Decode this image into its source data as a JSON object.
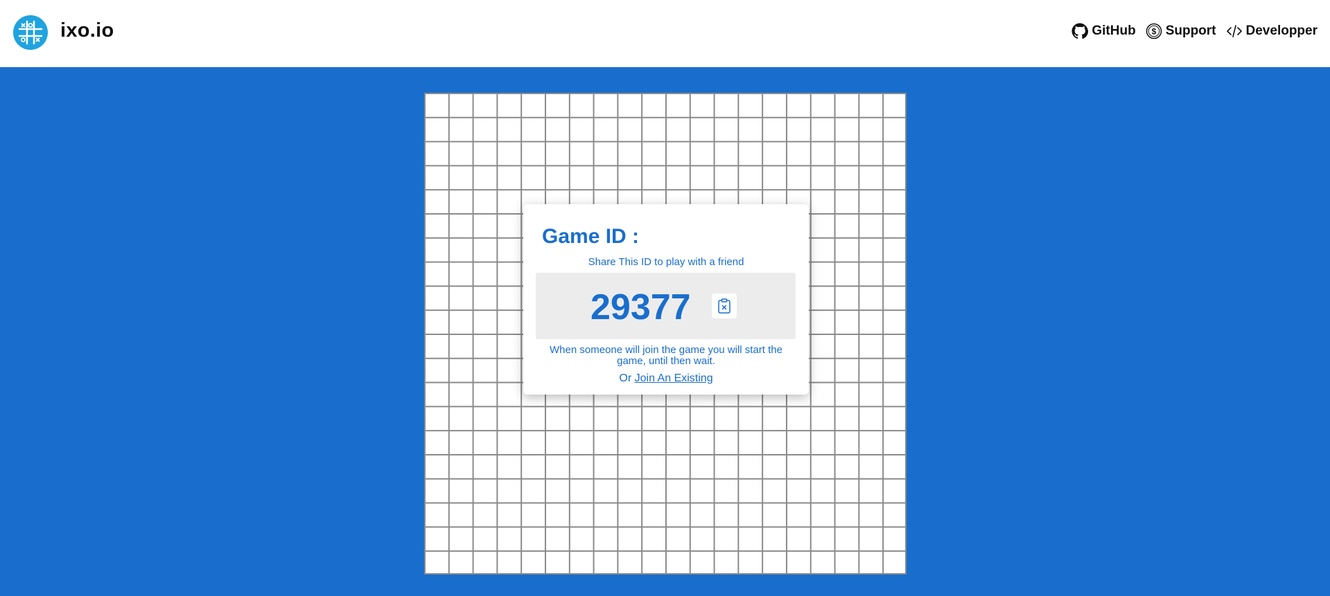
{
  "header": {
    "brand": "ixo.io",
    "logo_icon": "tic-tac-toe-logo-icon",
    "nav": [
      {
        "label": "GitHub",
        "icon": "github-icon"
      },
      {
        "label": "Support",
        "icon": "dollar-coin-icon"
      },
      {
        "label": "Developper",
        "icon": "code-icon"
      }
    ]
  },
  "board": {
    "rows": 20,
    "cols": 20
  },
  "dialog": {
    "title": "Game ID :",
    "subtitle": "Share This ID to play with a friend",
    "game_id": "29377",
    "copy_icon": "clipboard-icon",
    "wait_text": "When someone will join the game you will start the game, until then wait.",
    "join_prefix": "Or",
    "join_link": "Join An Existing"
  },
  "colors": {
    "background": "#196ecd",
    "logo": "#1fa3e0",
    "accent": "#196ecd"
  }
}
